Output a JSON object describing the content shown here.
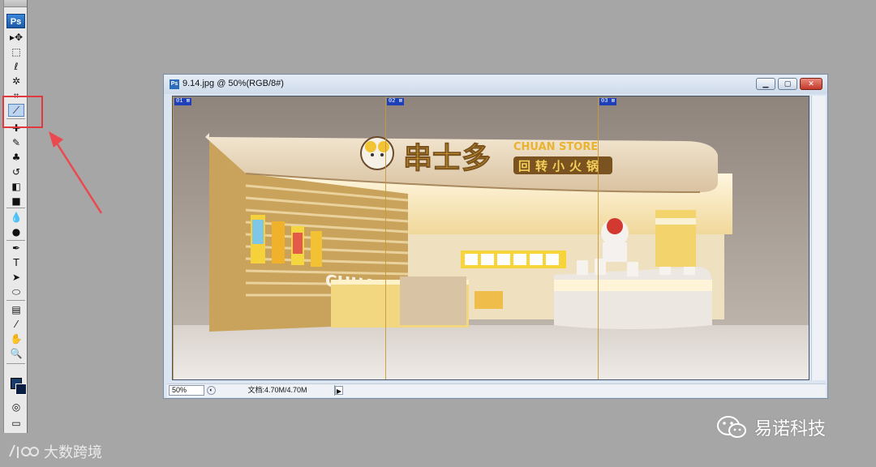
{
  "toolbox": {
    "logo": "Ps",
    "tools": [
      {
        "name": "move-tool",
        "glyph": "▸✥",
        "active": false
      },
      {
        "name": "marquee-tool",
        "glyph": "⬚",
        "active": false
      },
      {
        "name": "lasso-tool",
        "glyph": "ℓ",
        "active": false
      },
      {
        "name": "magic-wand-tool",
        "glyph": "✲",
        "active": false
      },
      {
        "name": "crop-tool",
        "glyph": "⌗",
        "active": false
      },
      {
        "name": "slice-tool",
        "glyph": "⟋",
        "active": true
      },
      {
        "name": "healing-brush-tool",
        "glyph": "✚",
        "active": false
      },
      {
        "name": "brush-tool",
        "glyph": "✎",
        "active": false
      },
      {
        "name": "clone-stamp-tool",
        "glyph": "♣",
        "active": false
      },
      {
        "name": "history-brush-tool",
        "glyph": "↺",
        "active": false
      },
      {
        "name": "eraser-tool",
        "glyph": "◧",
        "active": false
      },
      {
        "name": "gradient-tool",
        "glyph": "■",
        "active": false
      },
      {
        "name": "blur-tool",
        "glyph": "💧",
        "active": false
      },
      {
        "name": "dodge-tool",
        "glyph": "●",
        "active": false
      },
      {
        "name": "pen-tool",
        "glyph": "✒",
        "active": false
      },
      {
        "name": "type-tool",
        "glyph": "T",
        "active": false
      },
      {
        "name": "path-selection-tool",
        "glyph": "➤",
        "active": false
      },
      {
        "name": "shape-tool",
        "glyph": "⬭",
        "active": false
      },
      {
        "name": "notes-tool",
        "glyph": "▤",
        "active": false
      },
      {
        "name": "eyedropper-tool",
        "glyph": "⁄",
        "active": false
      },
      {
        "name": "hand-tool",
        "glyph": "✋",
        "active": false
      },
      {
        "name": "zoom-tool",
        "glyph": "🔍",
        "active": false
      }
    ],
    "quick_mask_glyph": "◎",
    "screen_mode_glyph": "▭"
  },
  "document": {
    "title": "9.14.jpg @ 50%(RGB/8#)",
    "ps_icon": "Ps",
    "min_glyph": "▁",
    "max_glyph": "▢",
    "close_glyph": "✕",
    "slices": [
      "01",
      "02",
      "03"
    ],
    "image": {
      "brand_cn": "串士多",
      "brand_en": "CHUAN STORE",
      "sub_cn": "回转小火锅",
      "side_text": "CHUAN STORE"
    },
    "status": {
      "zoom": "50%",
      "info": "文档:4.70M/4.70M"
    }
  },
  "watermarks": {
    "right": "易诺科技",
    "left": "大数跨境"
  },
  "colors": {
    "app_bg": "#a6a6a6",
    "highlight": "#e0393e",
    "accent": "#2d6dbb"
  }
}
